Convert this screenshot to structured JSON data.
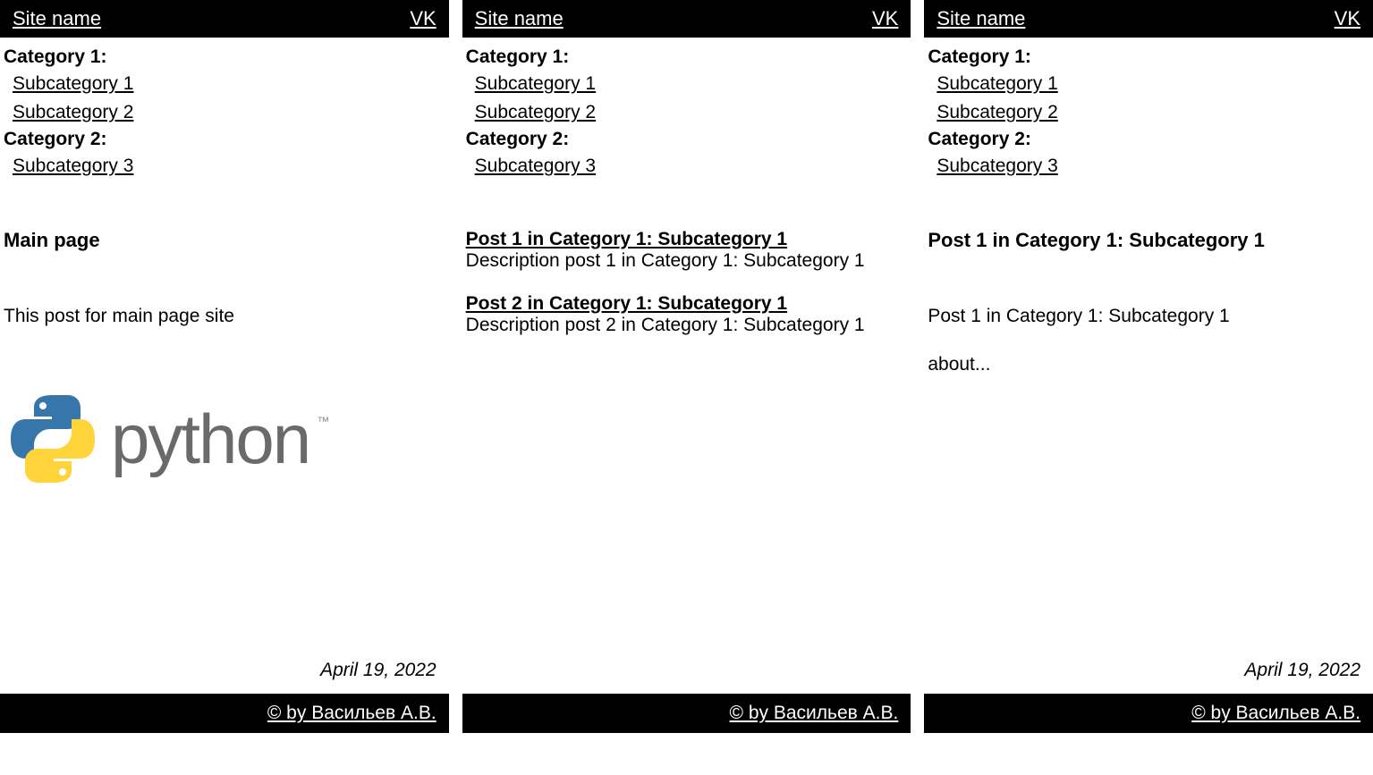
{
  "header": {
    "site_name": "Site name",
    "vk": "VK"
  },
  "nav": {
    "cat1": "Category 1:",
    "sub1": "Subcategory 1",
    "sub2": "Subcategory 2",
    "cat2": "Category 2:",
    "sub3": "Subcategory 3"
  },
  "panel1": {
    "title": "Main page",
    "body": "This post for main page site",
    "logo_text": "python",
    "tm": "™",
    "date": "April 19, 2022"
  },
  "panel2": {
    "posts": [
      {
        "title": "Post 1 in Category 1: Subcategory 1",
        "desc": "Description post 1 in Category 1: Subcategory 1"
      },
      {
        "title": "Post 2 in Category 1: Subcategory 1",
        "desc": "Description post 2 in Category 1: Subcategory 1"
      }
    ]
  },
  "panel3": {
    "title": "Post 1 in Category 1: Subcategory 1",
    "body": "Post 1 in Category 1: Subcategory 1",
    "about": "about...",
    "date": "April 19, 2022"
  },
  "footer": {
    "copyright": "© by Васильев А.В."
  }
}
